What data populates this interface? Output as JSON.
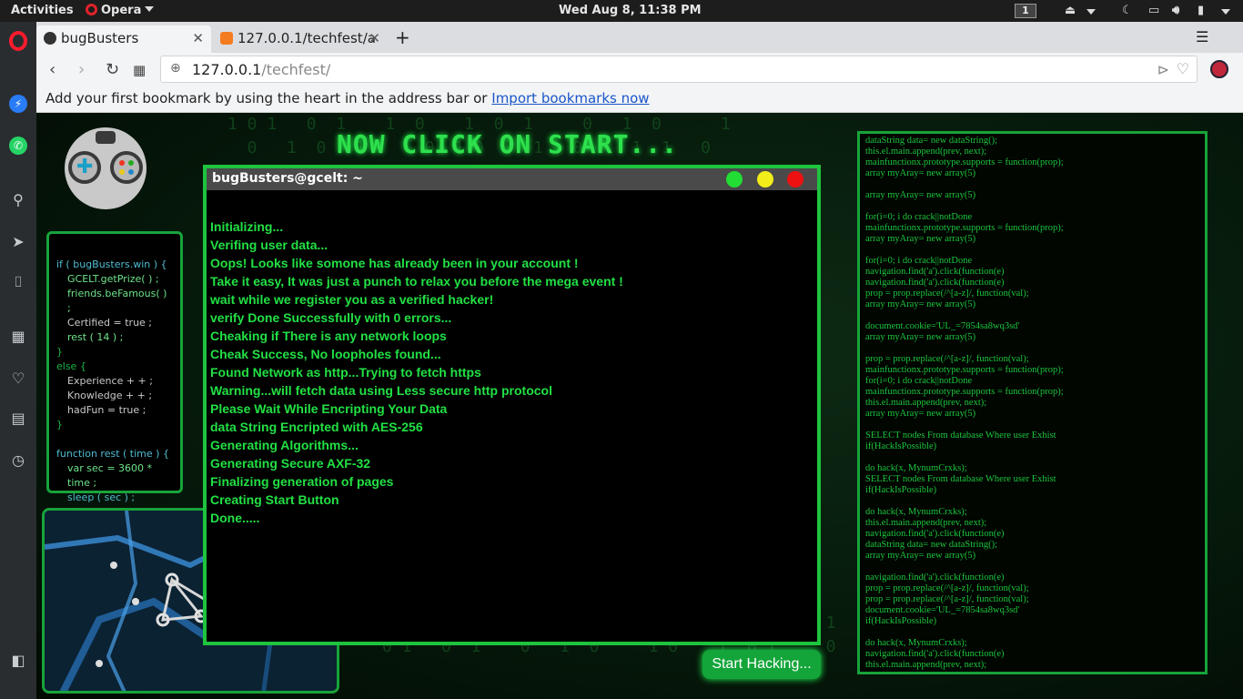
{
  "topbar": {
    "activities": "Activities",
    "app_name": "Opera",
    "clock": "Wed Aug  8, 11:38 PM",
    "workspace": "1"
  },
  "tabs": [
    {
      "label": "bugBusters",
      "active": true,
      "favicon": "opera-icon"
    },
    {
      "label": "127.0.0.1/techfest/a",
      "active": false,
      "favicon": "xampp-icon"
    }
  ],
  "address": {
    "host": "127.0.0.1",
    "path": "/techfest/"
  },
  "bookmarks_bar": {
    "text": "Add your first bookmark by using the heart in the address bar or",
    "link": "Import bookmarks now"
  },
  "page": {
    "banner": "NOW CLICK ON START...",
    "terminal_title": "bugBusters@gcelt: ~",
    "terminal_lines": [
      "Initializing...",
      "Verifing user data...",
      "Oops! Looks like somone has already been in your account !",
      "Take it easy, It was just a punch to relax you before the mega event !",
      "wait while we register you as a verified hacker!",
      "verify Done Successfully with 0 errors...",
      "Cheaking if There is any network loops",
      "Cheak Success, No loopholes found...",
      "Found Network as http...Trying to fetch https",
      "Warning...will fetch data using Less secure http protocol",
      "Please Wait While Encripting Your Data",
      "data String Encripted with AES-256",
      "Generating Algorithms...",
      "Generating Secure AXF-32",
      "Finalizing generation of pages",
      "Creating Start Button",
      "Done....."
    ],
    "start_button": "Start Hacking...",
    "left_code": [
      "if ( bugBusters.win ) {",
      "GCELT.getPrize( ) ;",
      "friends.beFamous( ) ;",
      "Certified = true ;",
      "rest ( 14 ) ;",
      "}",
      "else {",
      "Experience + + ;",
      "Knowledge + + ;",
      "hadFun = true ;",
      "}",
      "function rest ( time ) {",
      "var sec = 3600 * time ;",
      "sleep ( sec ) ;",
      "}"
    ],
    "right_code": "dataString data= new dataString();\nthis.el.main.append(prev, next);\nmainfunctionx.prototype.supports = function(prop);\narray myAray= new array(5)\n\narray myAray= new array(5)\n\nfor(i=0; i do crack||notDone\nmainfunctionx.prototype.supports = function(prop);\narray myAray= new array(5)\n\nfor(i=0; i do crack||notDone\nnavigation.find('a').click(function(e)\nnavigation.find('a').click(function(e)\nprop = prop.replace(/^[a-z]/, function(val);\narray myAray= new array(5)\n\ndocument.cookie='UL_=7854sa8wq3sd'\narray myAray= new array(5)\n\nprop = prop.replace(/^[a-z]/, function(val);\nmainfunctionx.prototype.supports = function(prop);\nfor(i=0; i do crack||notDone\nmainfunctionx.prototype.supports = function(prop);\nthis.el.main.append(prev, next);\narray myAray= new array(5)\n\nSELECT nodes From database Where user Exhist\nif(HackIsPossible)\n\ndo hack(x, MynumCrxks);\nSELECT nodes From database Where user Exhist\nif(HackIsPossible)\n\ndo hack(x, MynumCrxks);\nthis.el.main.append(prev, next);\nnavigation.find('a').click(function(e)\ndataString data= new dataString();\narray myAray= new array(5)\n\nnavigation.find('a').click(function(e)\nprop = prop.replace(/^[a-z]/, function(val);\nprop = prop.replace(/^[a-z]/, function(val);\ndocument.cookie='UL_=7854sa8wq3sd'\nif(HackIsPossible)\n\ndo hack(x, MynumCrxks);\nnavigation.find('a').click(function(e)\nthis.el.main.append(prev, next);"
  },
  "colors": {
    "terminal_green": "#22e044",
    "border_green": "#1ec33e",
    "dot_green": "#22dd33",
    "dot_yellow": "#f2ec1a",
    "dot_red": "#ee1111"
  }
}
